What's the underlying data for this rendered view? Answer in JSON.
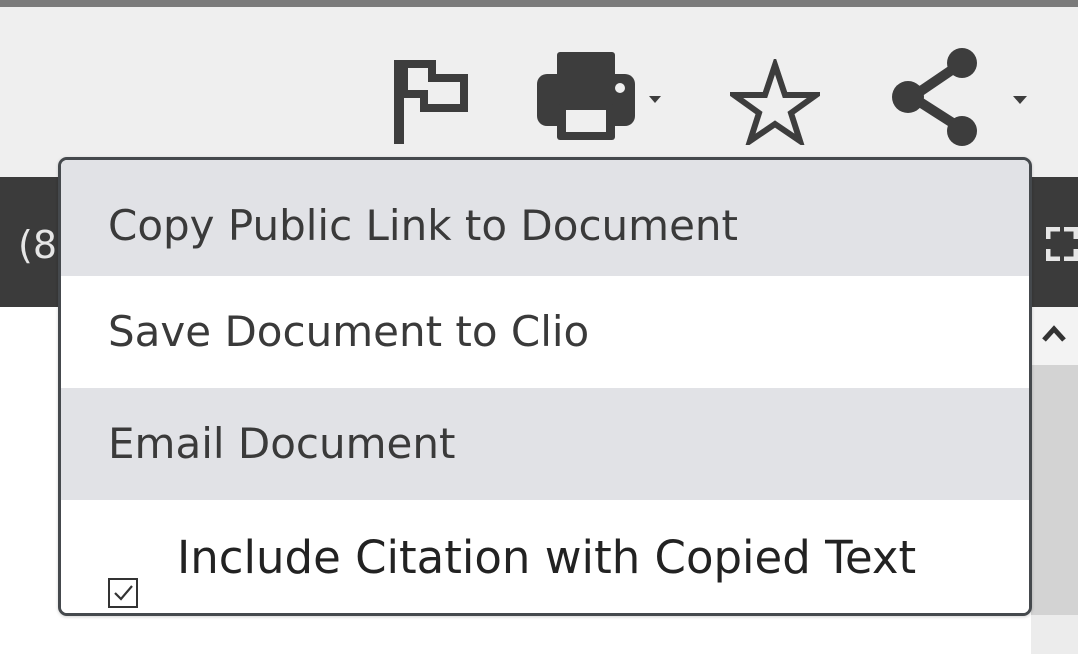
{
  "toolbar": {
    "icons": [
      "flag-icon",
      "print-icon",
      "chevron-down-icon",
      "star-icon",
      "share-icon",
      "chevron-down-icon"
    ]
  },
  "background_bar": {
    "partial_text": "(8"
  },
  "share_menu": {
    "items": [
      {
        "label": "Copy Public Link to Document"
      },
      {
        "label": "Save Document to Clio"
      },
      {
        "label": "Email Document"
      }
    ],
    "checkbox": {
      "label": "Include Citation with Copied Text",
      "checked": true
    }
  },
  "colors": {
    "toolbar_bg": "#efefef",
    "icon": "#3d3d3d",
    "menu_border": "#45494d",
    "menu_item_highlight": "#e1e2e6",
    "dark_bar": "#3b3b3b"
  }
}
